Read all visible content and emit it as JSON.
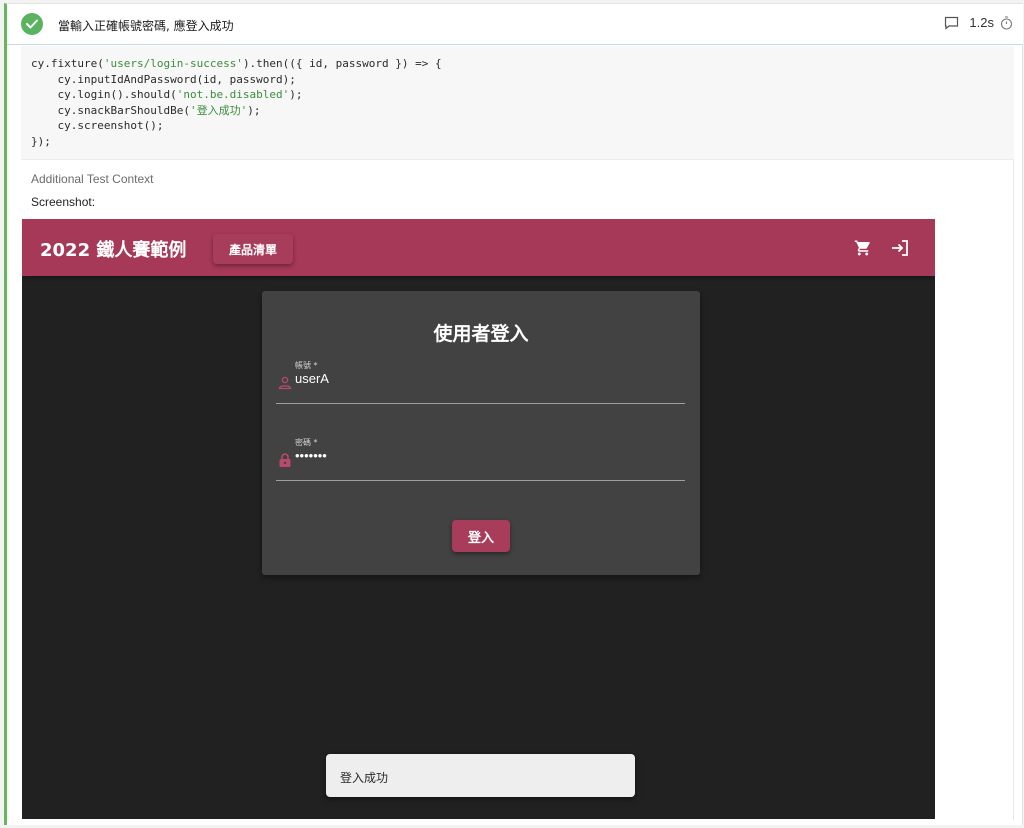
{
  "test": {
    "title": "當輸入正確帳號密碼, 應登入成功",
    "duration": "1.2s",
    "status": "passed",
    "status_color": "#59b35f"
  },
  "code": {
    "lines": [
      [
        {
          "t": "cy.fixture("
        },
        {
          "t": "'users/login-success'",
          "s": true
        },
        {
          "t": ").then(({ id, password }) => {"
        }
      ],
      [
        {
          "t": "    cy.inputIdAndPassword(id, password);"
        }
      ],
      [
        {
          "t": "    cy.login().should("
        },
        {
          "t": "'not.be.disabled'",
          "s": true
        },
        {
          "t": ");"
        }
      ],
      [
        {
          "t": "    cy.snackBarShouldBe("
        },
        {
          "t": "'登入成功'",
          "s": true
        },
        {
          "t": ");"
        }
      ],
      [
        {
          "t": "    cy.screenshot();"
        }
      ],
      [
        {
          "t": "});"
        }
      ]
    ]
  },
  "context": {
    "label": "Additional Test Context",
    "screenshot_label": "Screenshot:"
  },
  "app": {
    "brand": "2022 鐵人賽範例",
    "nav_button": "產品清單",
    "accent_color": "#a63858",
    "card_title": "使用者登入",
    "fields": [
      {
        "label": "帳號 *",
        "value": "userA",
        "icon": "person-icon"
      },
      {
        "label": "密碼 *",
        "value": "•••••••",
        "icon": "lock-icon"
      }
    ],
    "submit_label": "登入",
    "snackbar": "登入成功"
  }
}
